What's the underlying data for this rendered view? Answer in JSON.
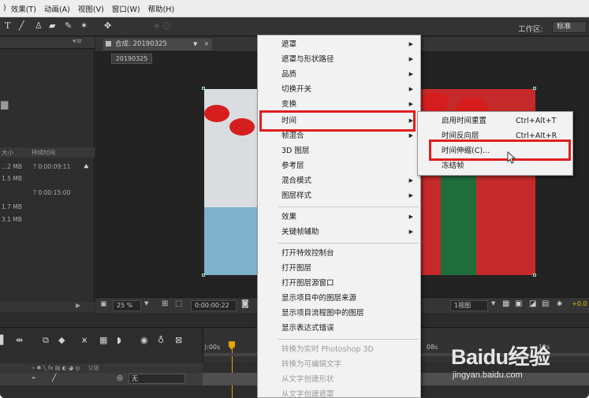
{
  "menubar": {
    "items": [
      "效果(T)",
      "动画(A)",
      "视图(V)",
      "窗口(W)",
      "帮助(H)"
    ]
  },
  "toolbar": {
    "workspace_label": "工作区:",
    "workspace_value": "标准"
  },
  "project": {
    "columns": [
      "大小",
      "持续时间"
    ],
    "rows": [
      {
        "size": "...2 MB",
        "duration": "? 0:00:09:11"
      },
      {
        "size": "1.5 MB",
        "duration": ""
      },
      {
        "size": "",
        "duration": "? 0:00:15:00"
      },
      {
        "size": "1.7 MB",
        "duration": ""
      },
      {
        "size": "3.1 MB",
        "duration": ""
      }
    ]
  },
  "composition": {
    "tab_label": "合成: 20190325",
    "breadcrumb": "20190325",
    "zoom": "25 %",
    "timecode": "0:00:00:22",
    "view_count": "1视图",
    "exposure": "+0.0"
  },
  "context_menu": {
    "items": [
      {
        "label": "遮罩",
        "submenu": true,
        "disabled": false
      },
      {
        "label": "遮罩与形状路径",
        "submenu": true,
        "disabled": false
      },
      {
        "label": "品质",
        "submenu": true,
        "disabled": false
      },
      {
        "label": "切换开关",
        "submenu": true,
        "disabled": false
      },
      {
        "label": "变换",
        "submenu": true,
        "disabled": false
      },
      {
        "label": "时间",
        "submenu": true,
        "disabled": false
      },
      {
        "label": "帧混合",
        "submenu": true,
        "disabled": false
      },
      {
        "label": "3D 图层",
        "submenu": false,
        "disabled": false
      },
      {
        "label": "参考层",
        "submenu": false,
        "disabled": false
      },
      {
        "label": "混合模式",
        "submenu": true,
        "disabled": false
      },
      {
        "label": "图层样式",
        "submenu": true,
        "disabled": false
      },
      {
        "label": "效果",
        "submenu": true,
        "disabled": false
      },
      {
        "label": "关键帧辅助",
        "submenu": true,
        "disabled": false
      },
      {
        "label": "打开特效控制台",
        "submenu": false,
        "disabled": false
      },
      {
        "label": "打开图层",
        "submenu": false,
        "disabled": false
      },
      {
        "label": "打开图层源窗口",
        "submenu": false,
        "disabled": false
      },
      {
        "label": "显示项目中的图层来源",
        "submenu": false,
        "disabled": false
      },
      {
        "label": "显示项目流程图中的图层",
        "submenu": false,
        "disabled": false
      },
      {
        "label": "显示表达式错误",
        "submenu": false,
        "disabled": false
      },
      {
        "label": "转换为实时 Photoshop 3D",
        "submenu": false,
        "disabled": true
      },
      {
        "label": "转换为可编辑文字",
        "submenu": false,
        "disabled": true
      },
      {
        "label": "从文字创建形状",
        "submenu": false,
        "disabled": true
      },
      {
        "label": "从文字创建遮罩",
        "submenu": false,
        "disabled": true
      }
    ]
  },
  "time_submenu": {
    "items": [
      {
        "label": "启用时间重置",
        "shortcut": "Ctrl+Alt+T"
      },
      {
        "label": "时间反向层",
        "shortcut": "Ctrl+Alt+R"
      },
      {
        "label": "时间伸缩(C)...",
        "shortcut": ""
      },
      {
        "label": "冻结帧",
        "shortcut": ""
      }
    ]
  },
  "timeline": {
    "ruler_labels": [
      "):00s",
      "08s",
      "12s"
    ],
    "layer_header": "父级",
    "parent_value": "无"
  },
  "watermark": {
    "logo": "Baidu经验",
    "url": "jingyan.baidu.com"
  },
  "colors": {
    "highlight_red": "#e01e1e",
    "menu_bg": "#f2f2f2",
    "panel_bg": "#2b2b2b"
  }
}
